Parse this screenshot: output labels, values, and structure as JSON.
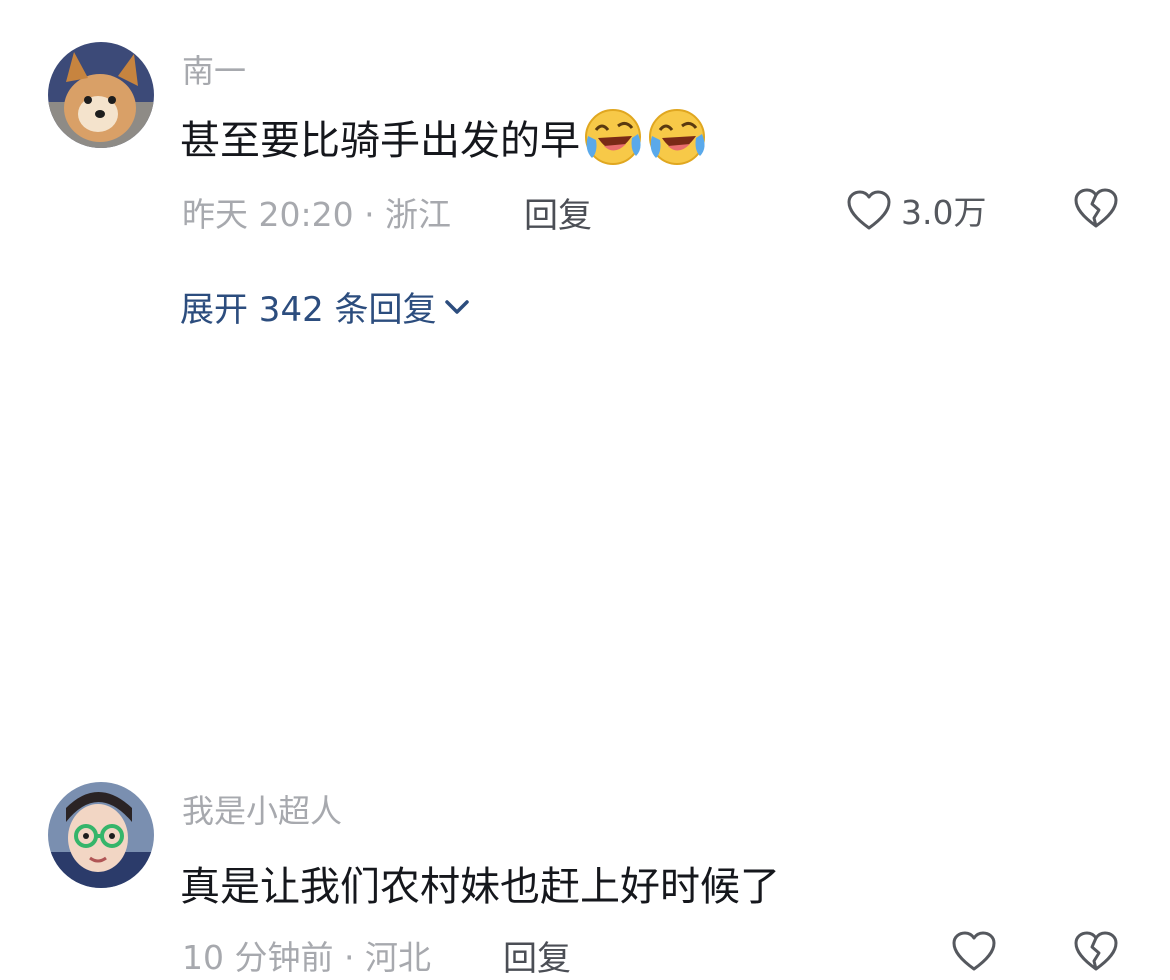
{
  "comments": [
    {
      "username": "南一",
      "text": "甚至要比骑手出发的早",
      "emoji": "laughing-crying-emoji",
      "meta": "昨天 20:20 · 浙江",
      "reply_label": "回复",
      "like_count": "3.0万",
      "expand_replies": "展开 342 条回复"
    },
    {
      "username": "我是小超人",
      "text": "真是让我们农村妹也赶上好时候了",
      "meta": "10 分钟前 · 河北",
      "reply_label": "回复"
    }
  ],
  "colors": {
    "text": "#15171c",
    "muted": "#a7a9ae",
    "link": "#2c4d7e"
  }
}
